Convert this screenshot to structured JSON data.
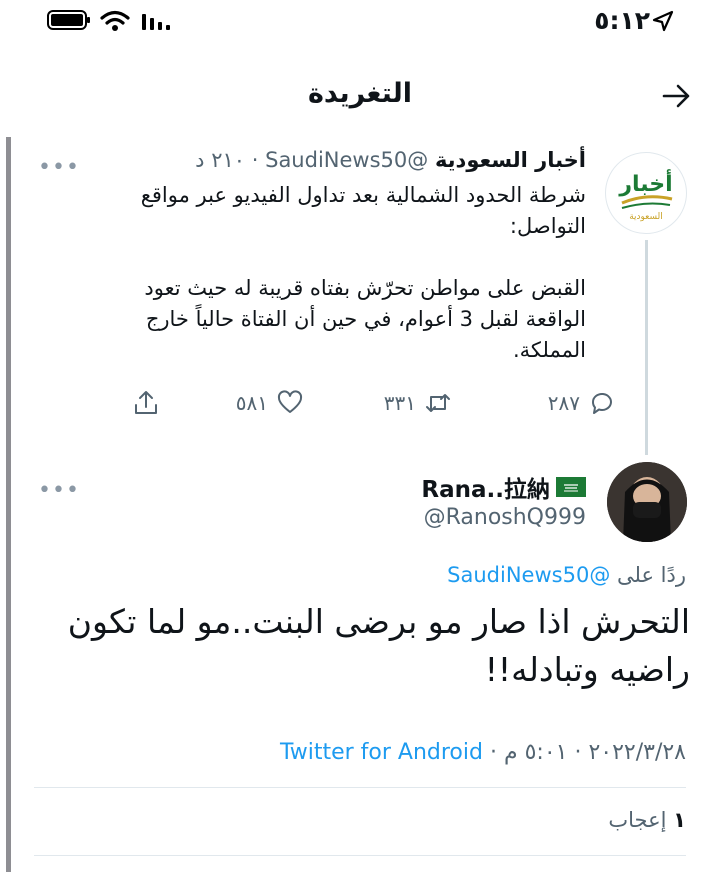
{
  "status_bar": {
    "time": "٥:١٢"
  },
  "header": {
    "title": "التغريدة"
  },
  "tweet1": {
    "display_name": "أخبار السعودية",
    "handle": "@SaudiNews50",
    "age": "٢١٠ د",
    "avatar_text": "أخبار",
    "avatar_subtext": "السعودية",
    "lines": [
      "شرطة الحدود الشمالية بعد تداول الفيديو عبر مواقع",
      "التواصل:",
      "القبض على مواطن تحرّش بفتاه قريبة له حيث تعود",
      "الواقعة لقبل 3 أعوام، في حين أن الفتاة حالياً خارج",
      "المملكة."
    ],
    "replies": "٢٨٧",
    "retweets": "٣٣١",
    "likes": "٥٨١"
  },
  "tweet2": {
    "display_name": "Rana..拉納",
    "handle": "@RanoshQ999",
    "reply_prefix": "ردًا على",
    "reply_handle": "@SaudiNews50",
    "text_lines": [
      "التحرش اذا صار مو برضى البنت..مو لما تكون",
      "راضيه وتبادله!!"
    ],
    "date_time": "٢٠٢٢/٣/٢٨ · ٥:٠١ م",
    "source": "Twitter for Android",
    "like_count": "١",
    "like_label": "إعجاب"
  },
  "colors": {
    "link": "#1d9bf0",
    "secondary": "#536471",
    "brand_green": "#1c7a35",
    "brand_gold": "#c9a227"
  }
}
